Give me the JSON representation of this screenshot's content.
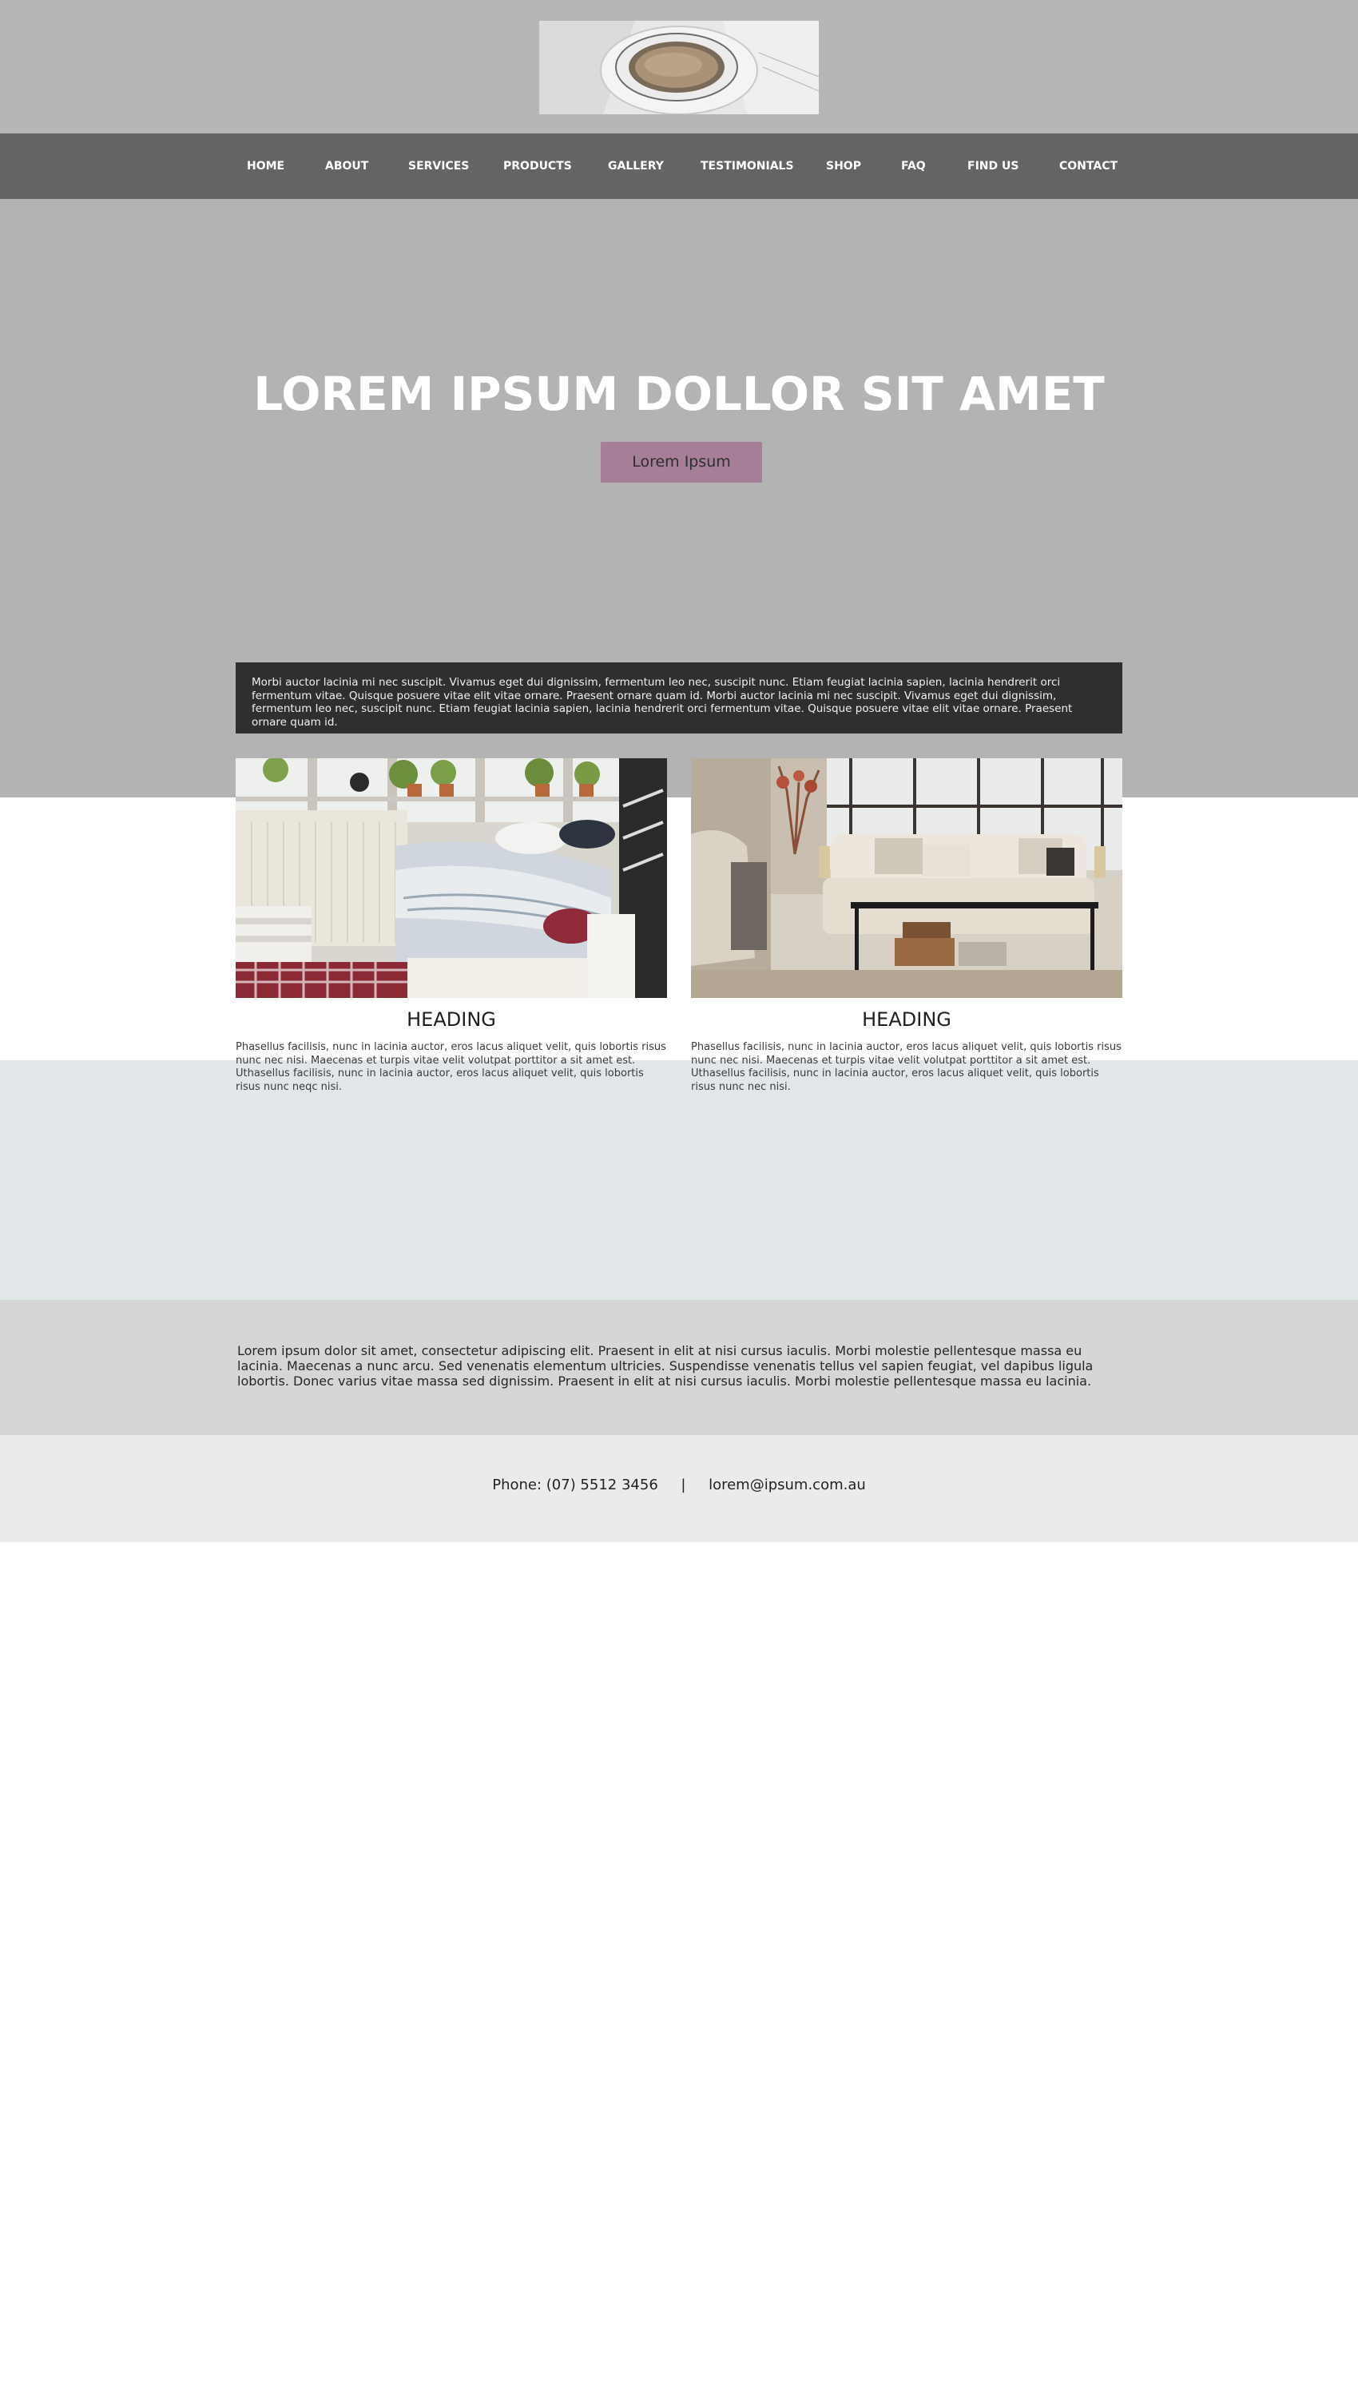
{
  "colors": {
    "header_bg": "#b6b6b6",
    "nav_bg": "#646464",
    "hero_bg": "#b3b3b3",
    "accent_button": "#a67e97",
    "intro_box_bg": "#302e30",
    "blue_band": "#e1e7e9",
    "grey_band": "#d6d6d6",
    "contact_band": "#ebebeb"
  },
  "nav": {
    "items": [
      {
        "label": "HOME"
      },
      {
        "label": "ABOUT"
      },
      {
        "label": "SERVICES"
      },
      {
        "label": "PRODUCTS"
      },
      {
        "label": "GALLERY"
      },
      {
        "label": "TESTIMONIALS"
      },
      {
        "label": "SHOP"
      },
      {
        "label": "FAQ"
      },
      {
        "label": "FIND US"
      },
      {
        "label": "CONTACT"
      }
    ]
  },
  "hero": {
    "title": "LOREM IPSUM DOLLOR SIT AMET",
    "button_label": "Lorem Ipsum"
  },
  "intro": {
    "text": "Morbi auctor lacinia mi nec suscipit. Vivamus eget dui dignissim, fermentum leo nec, suscipit nunc. Etiam feugiat lacinia sapien, lacinia hendrerit orci fermentum vitae. Quisque posuere vitae elit vitae ornare. Praesent ornare quam id. Morbi auctor lacinia mi nec suscipit. Vivamus eget dui dignissim, fermentum leo nec, suscipit nunc. Etiam feugiat lacinia sapien, lacinia hendrerit orci fermentum vitae. Quisque posuere vitae elit vitae ornare. Praesent ornare quam id."
  },
  "features": [
    {
      "heading": "HEADING",
      "text": "Phasellus facilisis, nunc in lacinia auctor, eros lacus aliquet velit, quis lobortis risus nunc nec nisi. Maecenas et turpis vitae velit volutpat porttitor a sit amet est. Uthasellus facilisis, nunc in lacinia auctor, eros lacus aliquet velit, quis lobortis risus nunc neqc nisi."
    },
    {
      "heading": "HEADING",
      "text": "Phasellus facilisis, nunc in lacinia auctor, eros lacus aliquet velit, quis lobortis risus nunc nec nisi. Maecenas et turpis vitae velit volutpat porttitor a sit amet est. Uthasellus facilisis, nunc in lacinia auctor, eros lacus aliquet velit, quis lobortis risus nunc nec nisi."
    }
  ],
  "about": {
    "text": "Lorem ipsum dolor sit amet, consectetur adipiscing elit. Praesent in elit at nisi cursus iaculis. Morbi molestie pellentesque massa eu lacinia. Maecenas a nunc arcu. Sed venenatis elementum ultricies. Suspendisse venenatis tellus vel sapien feugiat, vel dapibus ligula lobortis. Donec varius vitae massa sed dignissim.  Praesent in elit at nisi cursus iaculis. Morbi molestie pellentesque massa eu lacinia."
  },
  "contact": {
    "phone": "Phone: (07) 5512 3456",
    "separator": "|",
    "email": "lorem@ipsum.com.au"
  }
}
